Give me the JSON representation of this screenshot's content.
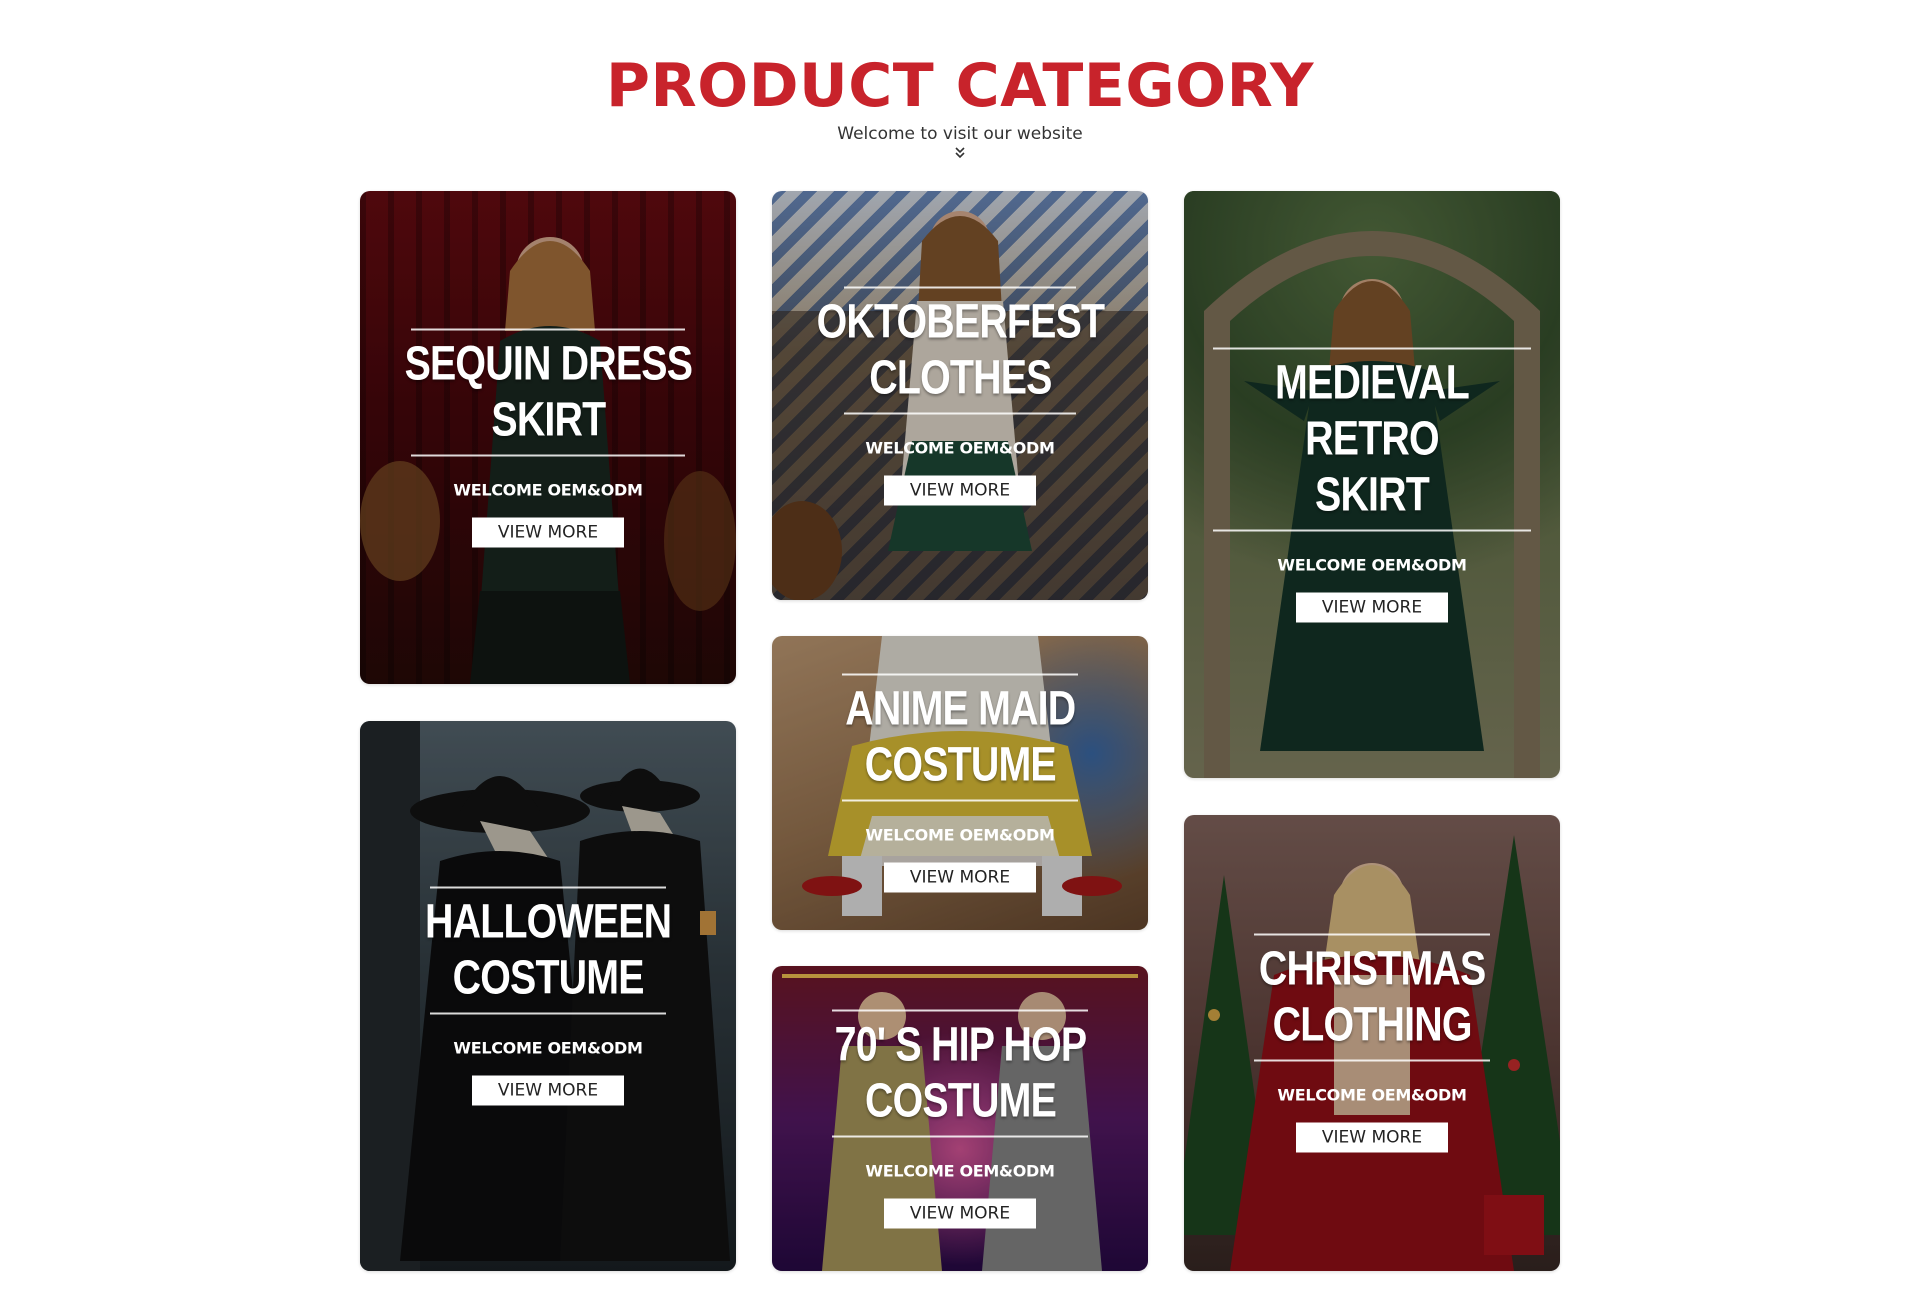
{
  "header": {
    "title": "PRODUCT CATEGORY",
    "subtitle": "Welcome to visit our website"
  },
  "cards": [
    {
      "line1": "SEQUIN DRESS",
      "line2": "SKIRT",
      "welcome": "WELCOME OEM&ODM",
      "button": "VIEW MORE"
    },
    {
      "line1": "OKTOBERFEST",
      "line2": "CLOTHES",
      "welcome": "WELCOME OEM&ODM",
      "button": "VIEW MORE"
    },
    {
      "line1": "MEDIEVAL RETRO",
      "line2": "SKIRT",
      "welcome": "WELCOME OEM&ODM",
      "button": "VIEW MORE"
    },
    {
      "line1": "ANIME MAID",
      "line2": "COSTUME",
      "welcome": "WELCOME OEM&ODM",
      "button": "VIEW MORE"
    },
    {
      "line1": "HALLOWEEN",
      "line2": "COSTUME",
      "welcome": "WELCOME OEM&ODM",
      "button": "VIEW MORE"
    },
    {
      "line1": "70' S HIP HOP",
      "line2": "COSTUME",
      "welcome": "WELCOME OEM&ODM",
      "button": "VIEW MORE"
    },
    {
      "line1": "CHRISTMAS",
      "line2": "CLOTHING",
      "welcome": "WELCOME OEM&ODM",
      "button": "VIEW MORE"
    }
  ],
  "icons": {
    "chevron": "double-chevron-down-icon"
  },
  "colors": {
    "title": "#c8232b",
    "button_bg": "#ffffff"
  }
}
